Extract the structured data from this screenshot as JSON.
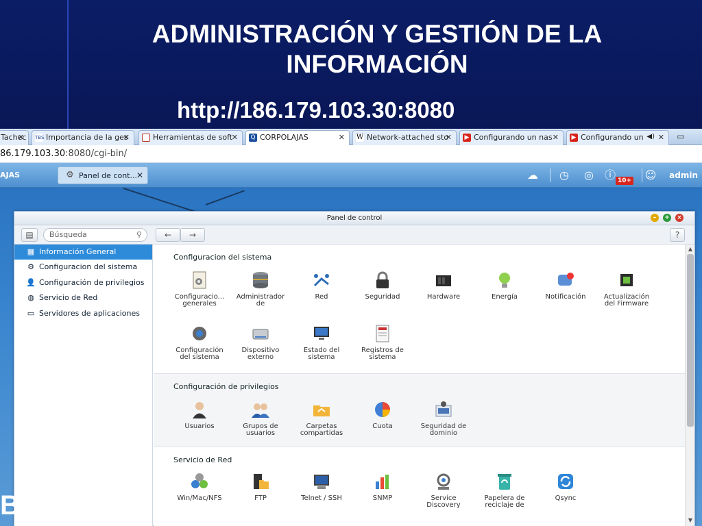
{
  "slide": {
    "title_line1": "ADMINISTRACIÓN Y GESTIÓN DE LA",
    "title_line2": "INFORMACIÓN",
    "url": "http://186.179.103.30:8080"
  },
  "browser": {
    "tabs": [
      {
        "label": "Tachec",
        "icon": "tab-icon",
        "active": false
      },
      {
        "label": "Importancia de la ges",
        "icon": "tbs-icon",
        "icon_text": "TBS",
        "active": false
      },
      {
        "label": "Herramientas de soft",
        "icon": "page-icon",
        "active": false
      },
      {
        "label": "CORPOLAJAS",
        "icon": "qnap-icon",
        "active": true
      },
      {
        "label": "Network-attached sto",
        "icon": "wikipedia-icon",
        "icon_text": "W",
        "active": false
      },
      {
        "label": "Configurando un nas",
        "icon": "youtube-icon",
        "active": false
      },
      {
        "label": "Configurando un",
        "icon": "youtube-icon",
        "active": false
      }
    ],
    "address_host": "86.179.103.30",
    "address_path": ":8080/cgi-bin/"
  },
  "app": {
    "brand": "AJAS",
    "open_tab": "Panel de cont...",
    "notification_count": "10+",
    "user": "admin"
  },
  "panel": {
    "title": "Panel de control",
    "search_placeholder": "Búsqueda",
    "help": "?",
    "sidebar": [
      {
        "label": "Información General",
        "icon": "grid-icon",
        "active": true
      },
      {
        "label": "Configuracion del sistema",
        "icon": "gear-icon",
        "active": false
      },
      {
        "label": "Configuración de privilegios",
        "icon": "user-icon",
        "active": false
      },
      {
        "label": "Servicio de Red",
        "icon": "globe-icon",
        "active": false
      },
      {
        "label": "Servidores de aplicaciones",
        "icon": "server-icon",
        "active": false
      }
    ],
    "sections": [
      {
        "title": "Configuracion del sistema",
        "items": [
          {
            "l1": "Configuracio...",
            "l2": "generales",
            "icon": "settings-doc-icon"
          },
          {
            "l1": "Administrador",
            "l2": "de",
            "icon": "storage-icon"
          },
          {
            "l1": "Red",
            "l2": "",
            "icon": "network-icon"
          },
          {
            "l1": "Seguridad",
            "l2": "",
            "icon": "lock-icon"
          },
          {
            "l1": "Hardware",
            "l2": "",
            "icon": "hardware-icon"
          },
          {
            "l1": "Energía",
            "l2": "",
            "icon": "bulb-icon"
          },
          {
            "l1": "Notificación",
            "l2": "",
            "icon": "notification-icon"
          },
          {
            "l1": "Actualización",
            "l2": "del Firmware",
            "icon": "chip-icon"
          },
          {
            "l1": "Configuración",
            "l2": "del sistema",
            "icon": "cog-icon"
          },
          {
            "l1": "Dispositivo",
            "l2": "externo",
            "icon": "drive-icon"
          },
          {
            "l1": "Estado del",
            "l2": "sistema",
            "icon": "monitor-icon"
          },
          {
            "l1": "Registros de",
            "l2": "sistema",
            "icon": "log-icon"
          }
        ]
      },
      {
        "title": "Configuración de privilegios",
        "items": [
          {
            "l1": "Usuarios",
            "l2": "",
            "icon": "user-icon"
          },
          {
            "l1": "Grupos de",
            "l2": "usuarios",
            "icon": "group-icon"
          },
          {
            "l1": "Carpetas",
            "l2": "compartidas",
            "icon": "folder-share-icon"
          },
          {
            "l1": "Cuota",
            "l2": "",
            "icon": "quota-icon"
          },
          {
            "l1": "Seguridad de",
            "l2": "dominio",
            "icon": "domain-icon"
          }
        ]
      },
      {
        "title": "Servicio de Red",
        "items": [
          {
            "l1": "Win/Mac/NFS",
            "l2": "",
            "icon": "winmac-icon"
          },
          {
            "l1": "FTP",
            "l2": "",
            "icon": "ftp-icon"
          },
          {
            "l1": "Telnet / SSH",
            "l2": "",
            "icon": "terminal-icon"
          },
          {
            "l1": "SNMP",
            "l2": "",
            "icon": "snmp-icon"
          },
          {
            "l1": "Service",
            "l2": "Discovery",
            "icon": "discovery-icon"
          },
          {
            "l1": "Papelera de",
            "l2": "reciclaje de",
            "icon": "recycle-icon"
          },
          {
            "l1": "Qsync",
            "l2": "",
            "icon": "sync-icon"
          }
        ]
      }
    ]
  },
  "colors": {
    "slide_bg": "#0b1d66",
    "selected": "#2e8bd9",
    "app_bar": "#4d8fcf"
  }
}
